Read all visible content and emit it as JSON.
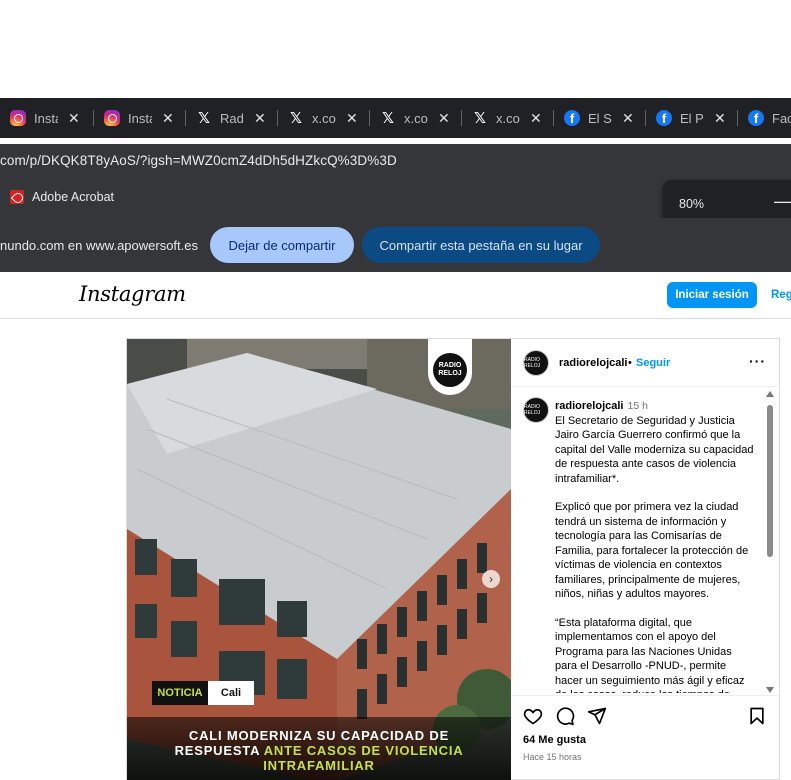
{
  "browser": {
    "tabs": [
      {
        "icon": "instagram-icon",
        "label": "Insta"
      },
      {
        "icon": "instagram-icon",
        "label": "Insta"
      },
      {
        "icon": "x-icon",
        "label": "Radio"
      },
      {
        "icon": "x-icon",
        "label": "x.com"
      },
      {
        "icon": "x-icon",
        "label": "x.com"
      },
      {
        "icon": "x-icon",
        "label": "x.com"
      },
      {
        "icon": "facebook-icon",
        "label": "El Sa"
      },
      {
        "icon": "facebook-icon",
        "label": "El Pa"
      },
      {
        "icon": "facebook-icon",
        "label": "Face"
      }
    ],
    "close_glyph": "✕",
    "url": "com/p/DKQK8T8yAoS/?igsh=MWZ0cmZ4dDh5dHZkcQ%3D%3D",
    "bookmark": "Adobe Acrobat",
    "zoom": {
      "value": "80%",
      "minus": "—"
    },
    "sharing": {
      "text": "nundo.com en www.apowersoft.es",
      "stop_button": "Dejar de compartir",
      "share_button": "Compartir esta pestaña en su lugar"
    }
  },
  "instagram": {
    "logo": "Instagram",
    "login_button": "Iniciar sesión",
    "register_link": "Regístrate"
  },
  "post": {
    "media": {
      "logo_text": "RADIO RELOJ",
      "tag_noticia": "NOTICIA",
      "tag_cali": "Cali",
      "headline_line1": "CALI MODERNIZA SU CAPACIDAD DE",
      "headline_line2a": "RESPUESTA ",
      "headline_line2b": "ANTE CASOS DE VIOLENCIA",
      "headline_line3": "INTRAFAMILIAR",
      "next_arrow": "›"
    },
    "header": {
      "username": "radiorelojcali",
      "dot": "•",
      "follow": "Seguir",
      "more": "···"
    },
    "caption": {
      "username": "radiorelojcali",
      "time": "15 h",
      "p1": "El Secretario de Seguridad y Justicia Jairo García Guerrero confirmó que la capital del Valle moderniza su capacidad de respuesta ante casos de violencia intrafamiliar*.",
      "p2": "Explicó que por primera vez la ciudad tendrá un sistema de información y tecnología para las Comisarías de Familia, para fortalecer la protección de víctimas de violencia en contextos familiares, principalmente de mujeres, niños, niñas y adultos mayores.",
      "p3": "“Esta plataforma digital, que implementamos con el apoyo del Programa para las Naciones Unidas para el Desarrollo -PNUD-, permite hacer un seguimiento más ágil y eficaz de los casos, reduce los tiempos de"
    },
    "likes": "64 Me gusta",
    "ago": "Hace 15 horas",
    "colors": {
      "accent": "#0095f6",
      "tag_green": "#c4e04a"
    }
  }
}
